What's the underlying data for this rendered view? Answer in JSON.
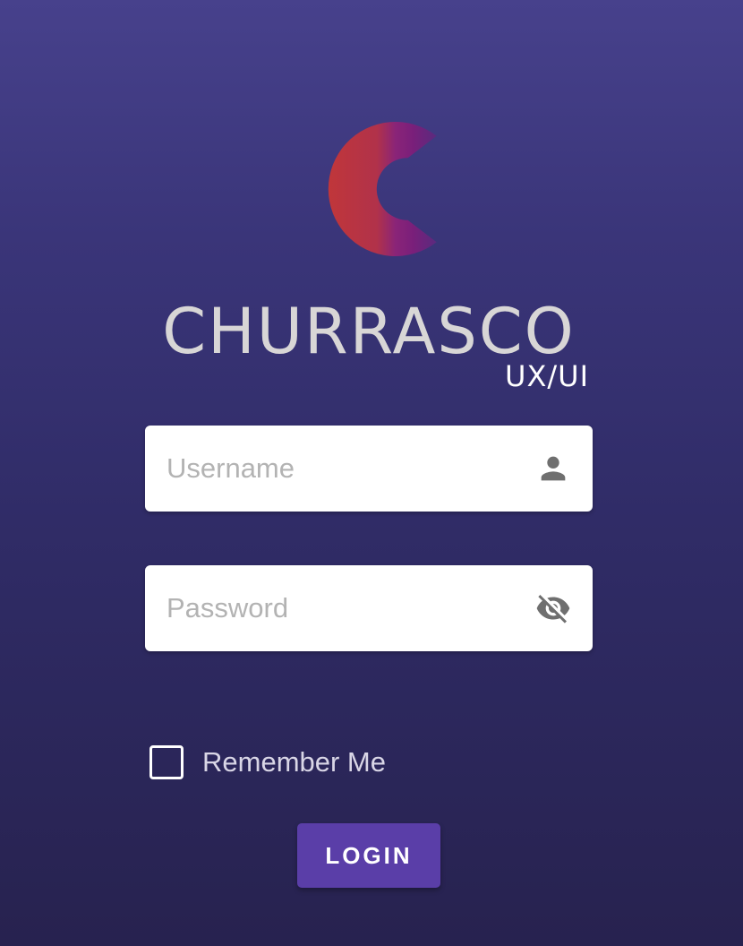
{
  "brand": {
    "logo_icon": "churrasco-c-logo",
    "logo_colors": [
      "#c0363a",
      "#8a2478",
      "#7a1f7a"
    ],
    "name": "CHURRASCO",
    "sub": "UX/UI"
  },
  "form": {
    "username": {
      "placeholder": "Username",
      "value": "",
      "icon": "person-icon"
    },
    "password": {
      "placeholder": "Password",
      "value": "",
      "icon": "eye-off-icon"
    },
    "remember": {
      "label": "Remember Me",
      "checked": false
    },
    "login_label": "LOGIN"
  },
  "colors": {
    "background_top": "#47418c",
    "background_bottom": "#27224f",
    "button": "#5a3ea8",
    "field_icon": "#6f6f6f"
  }
}
